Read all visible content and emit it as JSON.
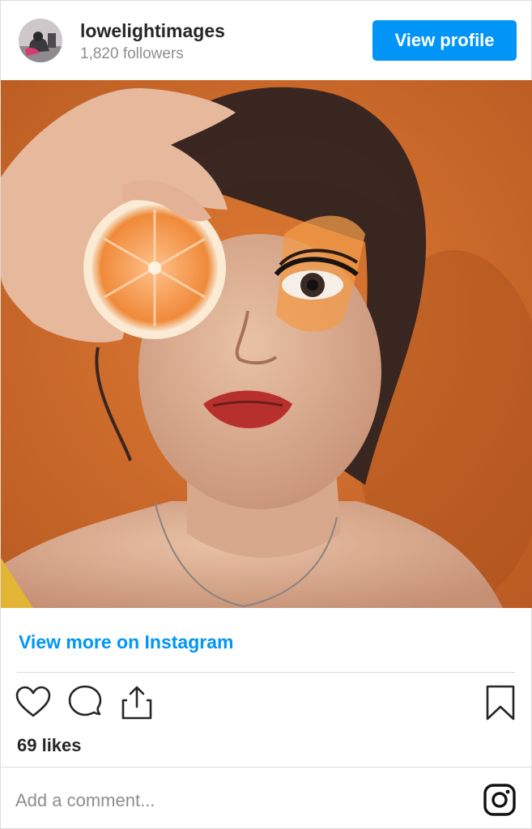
{
  "header": {
    "username": "lowelightimages",
    "followers": "1,820 followers",
    "view_profile_label": "View profile"
  },
  "post": {
    "view_more_label": "View more on Instagram",
    "likes": "69 likes",
    "comment_placeholder": "Add a comment..."
  },
  "icons": {
    "like": "heart-outline-icon",
    "comment": "speech-bubble-icon",
    "share": "share-upload-icon",
    "save": "bookmark-icon",
    "instagram": "instagram-logo-icon"
  },
  "colors": {
    "accent": "#0095f6",
    "text": "#262626",
    "muted": "#8e8e8e",
    "border": "#dbdbdb",
    "photo_background": "#d56e2c"
  }
}
